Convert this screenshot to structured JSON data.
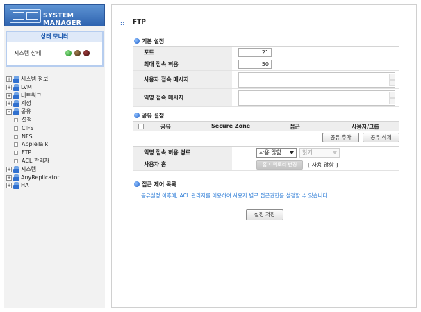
{
  "sidebar": {
    "logo_text": "SYSTEM MANAGER",
    "monitor": {
      "title": "상태 모니터",
      "status_label": "시스템 상태"
    },
    "tree": [
      {
        "label": "시스템 정보",
        "type": "folder",
        "expand": "+"
      },
      {
        "label": "LVM",
        "type": "folder",
        "expand": "+"
      },
      {
        "label": "네트워크",
        "type": "folder",
        "expand": "+"
      },
      {
        "label": "계정",
        "type": "folder",
        "expand": "+"
      },
      {
        "label": "공유",
        "type": "folder",
        "expand": "-"
      },
      {
        "label": "설정",
        "type": "child"
      },
      {
        "label": "CIFS",
        "type": "child"
      },
      {
        "label": "NFS",
        "type": "child"
      },
      {
        "label": "AppleTalk",
        "type": "child"
      },
      {
        "label": "FTP",
        "type": "child"
      },
      {
        "label": "ACL 관리자",
        "type": "child"
      },
      {
        "label": "시스템",
        "type": "folder",
        "expand": "+"
      },
      {
        "label": "AnyReplicator",
        "type": "folder",
        "expand": "+"
      },
      {
        "label": "HA",
        "type": "folder",
        "expand": "+"
      }
    ]
  },
  "main": {
    "title_icon": "::",
    "title": "FTP",
    "basic": {
      "heading": "기본 설정",
      "port_label": "포트",
      "port_value": "21",
      "max_conn_label": "최대 접속 허용",
      "max_conn_value": "50",
      "user_msg_label": "사용자 접속 메시지",
      "anon_msg_label": "익명 접속 메시지"
    },
    "share": {
      "heading": "공유 설정",
      "col_share": "공유",
      "col_secure": "Secure Zone",
      "col_access": "접근",
      "col_user": "사용자/그룹",
      "add_button": "공유 추가",
      "delete_button": "공유 삭제",
      "anon_path_label": "익명 접속 허용 경로",
      "anon_path_select": "사용 않함",
      "anon_perm_select": "읽기",
      "home_label": "사용자 홈",
      "home_button": "홈 디렉토리 변경",
      "home_status": "[ 사용 않함 ]"
    },
    "acl": {
      "heading": "접근 제어 목록",
      "description": "공유설정 이후에, ACL 관리자를 이용하여 사용자 별로 접근권한을 설정할 수 있습니다."
    },
    "save_button": "설정 저장"
  }
}
